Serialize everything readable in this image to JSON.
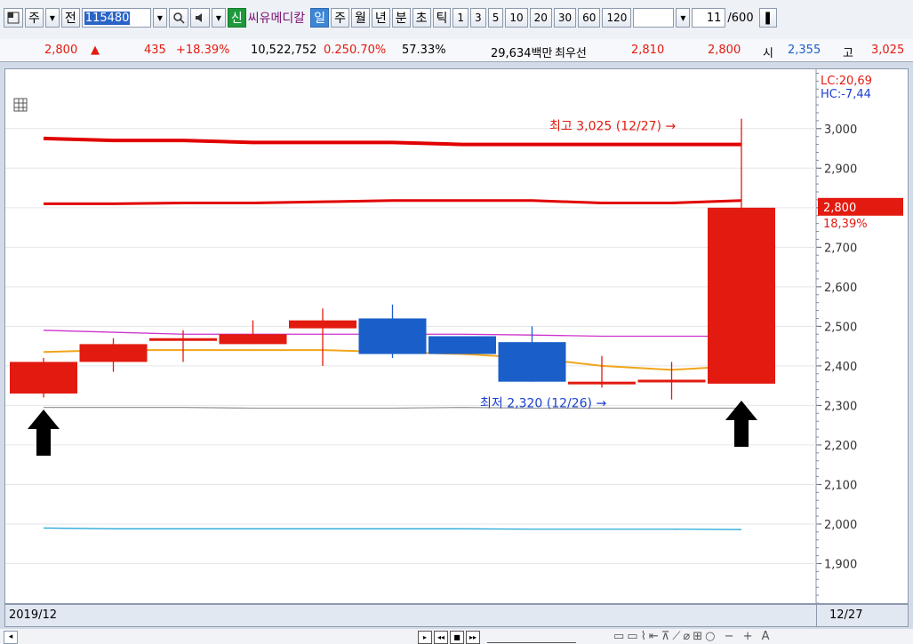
{
  "toolbar": {
    "period_1": "주",
    "type_2": "전",
    "code": "115480",
    "new_badge": "신",
    "stock_name": "씨유메디칼",
    "timeframes": [
      "일",
      "주",
      "월",
      "년",
      "분",
      "초",
      "틱"
    ],
    "active_timeframe": "일",
    "intervals": [
      "1",
      "3",
      "5",
      "10",
      "20",
      "30",
      "60",
      "120"
    ],
    "page_current": "11",
    "page_total": "/600"
  },
  "quote": {
    "price": "2,800",
    "change": "435",
    "change_pct": "+18.39%",
    "volume": "10,522,752",
    "turnover": "0.250.70%",
    "ratio": "57.33%",
    "amount": "29,634백만",
    "best_label": "최우선",
    "ask": "2,810",
    "bid": "2,800",
    "open_label": "시",
    "open": "2,355",
    "high_label": "고",
    "high": "3,025"
  },
  "colors": {
    "up": "#e21a0f",
    "down": "#1a5fc9",
    "ma_orange": "#f2a51a",
    "ma_magenta": "#cc33cc",
    "ma_cyan": "#29a9d9",
    "gray_line": "#999999",
    "band_red": "#e10000"
  },
  "chart_data": {
    "type": "candlestick",
    "ylim": [
      1800,
      3150
    ],
    "yticks": [
      1900,
      2000,
      2100,
      2200,
      2300,
      2400,
      2500,
      2600,
      2700,
      2800,
      2900,
      3000
    ],
    "candles": [
      {
        "o": 2330,
        "h": 2420,
        "l": 2320,
        "c": 2410
      },
      {
        "o": 2410,
        "h": 2470,
        "l": 2385,
        "c": 2455
      },
      {
        "o": 2470,
        "h": 2490,
        "l": 2410,
        "c": 2470
      },
      {
        "o": 2455,
        "h": 2515,
        "l": 2455,
        "c": 2480
      },
      {
        "o": 2495,
        "h": 2545,
        "l": 2400,
        "c": 2515
      },
      {
        "o": 2520,
        "h": 2555,
        "l": 2420,
        "c": 2430
      },
      {
        "o": 2475,
        "h": 2475,
        "l": 2430,
        "c": 2430
      },
      {
        "o": 2460,
        "h": 2500,
        "l": 2360,
        "c": 2360
      },
      {
        "o": 2360,
        "h": 2425,
        "l": 2345,
        "c": 2360
      },
      {
        "o": 2360,
        "h": 2410,
        "l": 2315,
        "c": 2365
      },
      {
        "o": 2355,
        "h": 3025,
        "l": 2355,
        "c": 2800
      }
    ],
    "series": [
      {
        "values": [
          2975,
          2970,
          2970,
          2965,
          2965,
          2965,
          2960,
          2960,
          2960,
          2960,
          2960
        ]
      },
      {
        "values": [
          2810,
          2810,
          2812,
          2812,
          2815,
          2818,
          2818,
          2818,
          2812,
          2812,
          2818
        ]
      },
      {
        "values": [
          2435,
          2440,
          2440,
          2440,
          2440,
          2435,
          2430,
          2420,
          2400,
          2390,
          2400
        ]
      },
      {
        "values": [
          2490,
          2485,
          2480,
          2480,
          2480,
          2480,
          2480,
          2478,
          2475,
          2475,
          2475
        ]
      },
      {
        "values": [
          2295,
          2295,
          2295,
          2293,
          2293,
          2293,
          2295,
          2293,
          2293,
          2293,
          2293
        ]
      },
      {
        "values": [
          1990,
          1988,
          1988,
          1988,
          1988,
          1988,
          1988,
          1987,
          1987,
          1987,
          1986
        ]
      }
    ],
    "annotations": {
      "high_text": "최고 3,025 (12/27) →",
      "low_text": "최저 2,320 (12/26) →",
      "lc": "LC:20,69",
      "hc": "HC:-7,44",
      "last_price": "2,800",
      "last_pct": "18,39%"
    },
    "x_start_label": "2019/12",
    "x_end_label": "12/27"
  }
}
